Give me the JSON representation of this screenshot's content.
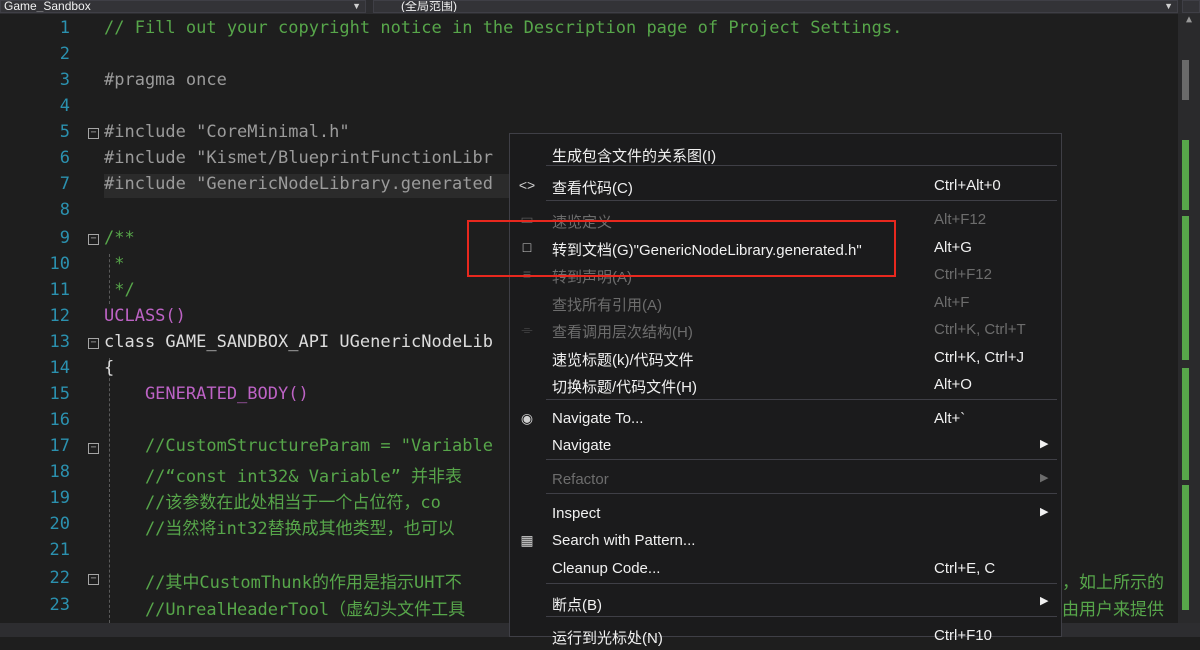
{
  "toolbar": {
    "project_combo": "Game_Sandbox",
    "scope_combo": "(全局范围)"
  },
  "editor": {
    "lines": [
      {
        "n": "1",
        "text": "// Fill out your copyright notice in the Description page of Project Settings."
      },
      {
        "n": "2",
        "text": ""
      },
      {
        "n": "3",
        "text": "#pragma once"
      },
      {
        "n": "4",
        "text": ""
      },
      {
        "n": "5",
        "text": "#include \"CoreMinimal.h\""
      },
      {
        "n": "6",
        "text": "#include \"Kismet/BlueprintFunctionLibr"
      },
      {
        "n": "7",
        "text": "#include \"GenericNodeLibrary.generated"
      },
      {
        "n": "8",
        "text": ""
      },
      {
        "n": "9",
        "text": "/**"
      },
      {
        "n": "10",
        "text": " *"
      },
      {
        "n": "11",
        "text": " */"
      },
      {
        "n": "12",
        "text": "UCLASS()"
      },
      {
        "n": "13",
        "text": "class GAME_SANDBOX_API UGenericNodeLib"
      },
      {
        "n": "14",
        "text": "{"
      },
      {
        "n": "15",
        "text": "    GENERATED_BODY()"
      },
      {
        "n": "16",
        "text": ""
      },
      {
        "n": "17",
        "text": "    //CustomStructureParam = \"Variable"
      },
      {
        "n": "18",
        "text": "    //“const int32& Variable” 并非表"
      },
      {
        "n": "19",
        "text": "    //该参数在此处相当于一个占位符，co"
      },
      {
        "n": "20",
        "text": "    //当然将int32替换成其他类型，也可以"
      },
      {
        "n": "21",
        "text": ""
      },
      {
        "n": "22",
        "text": "    //其中CustomThunk的作用是指示UHT不"
      },
      {
        "n": "23",
        "text": "    //UnrealHeaderTool（虚幻头文件工具"
      }
    ],
    "overflow_right_22": "，如上所示的",
    "overflow_right_23": "由用户来提供"
  },
  "context_menu": {
    "items": [
      {
        "icon": "",
        "label": "生成包含文件的关系图(I)",
        "shortcut": "",
        "disabled": false
      },
      {
        "icon": "code-view-icon",
        "label": "查看代码(C)",
        "shortcut": "Ctrl+Alt+0",
        "disabled": false
      },
      {
        "icon": "peek-definition-icon",
        "label": "速览定义",
        "shortcut": "Alt+F12",
        "disabled": true
      },
      {
        "icon": "goto-document-icon",
        "label": "转到文档(G)\"GenericNodeLibrary.generated.h\"",
        "shortcut": "Alt+G",
        "disabled": false
      },
      {
        "icon": "goto-declaration-icon",
        "label": "转到声明(A)",
        "shortcut": "Ctrl+F12",
        "disabled": true
      },
      {
        "icon": "",
        "label": "查找所有引用(A)",
        "shortcut": "Alt+F",
        "disabled": true
      },
      {
        "icon": "call-hierarchy-icon",
        "label": "查看调用层次结构(H)",
        "shortcut": "Ctrl+K, Ctrl+T",
        "disabled": true
      },
      {
        "icon": "",
        "label": "速览标题(k)/代码文件",
        "shortcut": "Ctrl+K, Ctrl+J",
        "disabled": false
      },
      {
        "icon": "",
        "label": "切换标题/代码文件(H)",
        "shortcut": "Alt+O",
        "disabled": false
      },
      {
        "icon": "navigate-to-icon",
        "label": "Navigate To...",
        "shortcut": "Alt+`",
        "disabled": false
      },
      {
        "icon": "",
        "label": "Navigate",
        "shortcut": "",
        "disabled": false,
        "submenu": true
      },
      {
        "icon": "",
        "label": "Refactor",
        "shortcut": "",
        "disabled": true,
        "submenu": true
      },
      {
        "icon": "",
        "label": "Inspect",
        "shortcut": "",
        "disabled": false,
        "submenu": true
      },
      {
        "icon": "search-pattern-icon",
        "label": "Search with Pattern...",
        "shortcut": "",
        "disabled": false
      },
      {
        "icon": "",
        "label": "Cleanup Code...",
        "shortcut": "Ctrl+E, C",
        "disabled": false
      },
      {
        "icon": "",
        "label": "断点(B)",
        "shortcut": "",
        "disabled": false,
        "submenu": true
      },
      {
        "icon": "",
        "label": "运行到光标处(N)",
        "shortcut": "Ctrl+F10",
        "disabled": false
      }
    ]
  },
  "colors": {
    "highlight_box": "#e8281e",
    "line_number": "#2b91af",
    "comment": "#57a64a"
  }
}
